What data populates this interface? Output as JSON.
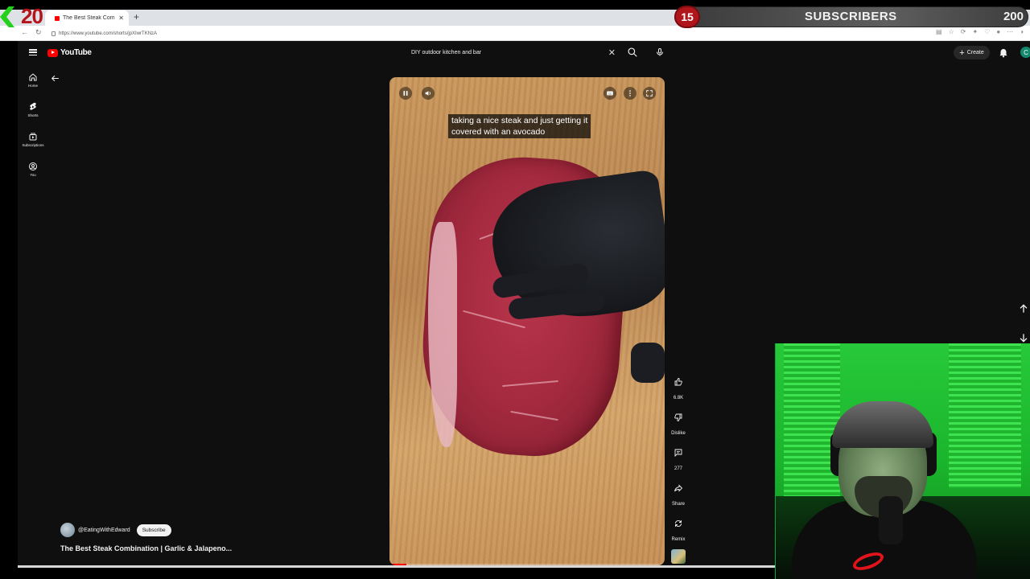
{
  "browser": {
    "tab_title": "The Best Steak Combination |",
    "url": "https://www.youtube.com/shorts/jpXIwrTKNzA"
  },
  "overlay": {
    "left_counter": "20",
    "sub_count": "15",
    "sub_label": "SUBSCRIBERS",
    "sub_goal": "200"
  },
  "youtube": {
    "logo_text": "YouTube",
    "search_value": "DIY outdoor kitchen and bar",
    "create_label": "Create",
    "account_initial": "C",
    "sidebar": [
      {
        "label": "Home"
      },
      {
        "label": "Shorts"
      },
      {
        "label": "Subscriptions"
      },
      {
        "label": "You"
      }
    ]
  },
  "video": {
    "caption_line1": "taking a nice steak and just getting it",
    "caption_line2": "covered with an avocado",
    "progress": 0.06,
    "channel": "@EatingWithEdward",
    "subscribe_label": "Subscribe",
    "title": "The Best Steak Combination | Garlic & Jalapeno..."
  },
  "actions": {
    "like_count": "6.8K",
    "dislike_label": "Dislike",
    "comment_count": "277",
    "share_label": "Share",
    "remix_label": "Remix"
  }
}
